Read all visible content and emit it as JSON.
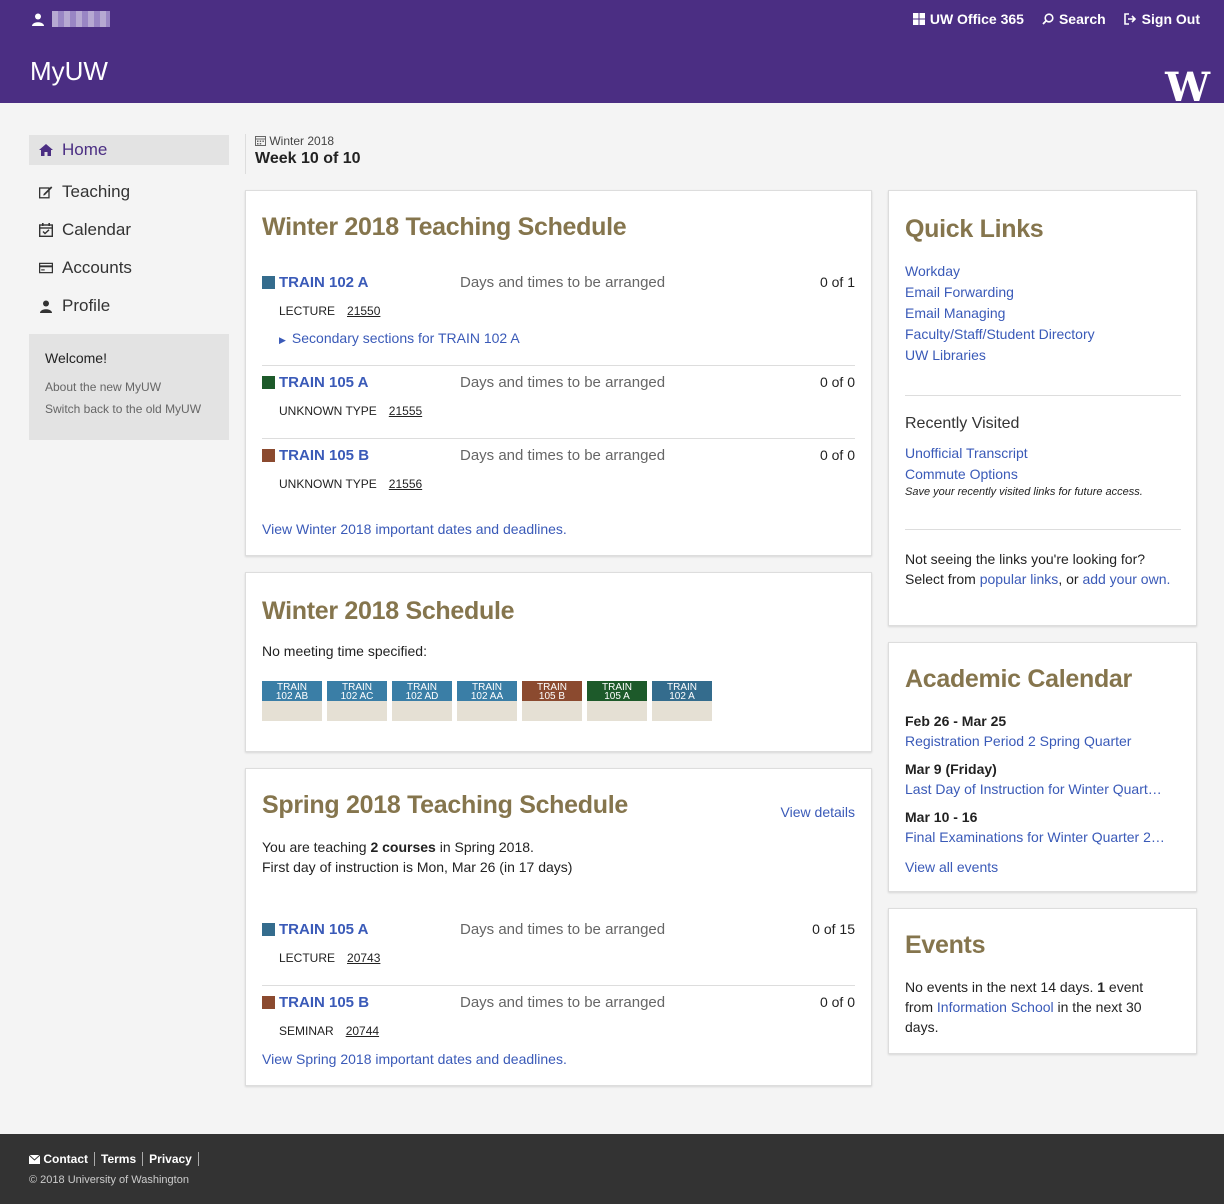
{
  "topbar": {
    "office": "UW Office 365",
    "search": "Search",
    "signout": "Sign Out"
  },
  "header": {
    "brand": "MyUW",
    "logo": "W"
  },
  "nav": [
    {
      "label": "Home",
      "icon": "home-icon"
    },
    {
      "label": "Teaching",
      "icon": "edit-icon"
    },
    {
      "label": "Calendar",
      "icon": "calendar-icon"
    },
    {
      "label": "Accounts",
      "icon": "credit-card-icon"
    },
    {
      "label": "Profile",
      "icon": "user-icon"
    }
  ],
  "welcome": {
    "title": "Welcome!",
    "about": "About the new MyUW",
    "switch": "Switch back to the old MyUW"
  },
  "term": {
    "quarter": "Winter 2018",
    "week": "Week 10 of 10"
  },
  "teaching_winter": {
    "title": "Winter 2018 Teaching Schedule",
    "courses": [
      {
        "name": "TRAIN 102 A",
        "when": "Days and times to be arranged",
        "count": "0 of 1",
        "type": "LECTURE",
        "sln": "21550",
        "color": "#346c8d",
        "secondary": "Secondary sections for TRAIN 102 A"
      },
      {
        "name": "TRAIN 105 A",
        "when": "Days and times to be arranged",
        "count": "0 of 0",
        "type": "UNKNOWN TYPE",
        "sln": "21555",
        "color": "#1d5a2a"
      },
      {
        "name": "TRAIN 105 B",
        "when": "Days and times to be arranged",
        "count": "0 of 0",
        "type": "UNKNOWN TYPE",
        "sln": "21556",
        "color": "#8b4a2f"
      }
    ],
    "dates_link": "View Winter 2018 important dates and deadlines."
  },
  "schedule": {
    "title": "Winter 2018 Schedule",
    "note": "No meeting time specified:",
    "blocks": [
      {
        "l1": "TRAIN",
        "l2": "102 AB",
        "color": "#3a7ea6"
      },
      {
        "l1": "TRAIN",
        "l2": "102 AC",
        "color": "#3a7ea6"
      },
      {
        "l1": "TRAIN",
        "l2": "102 AD",
        "color": "#3a7ea6"
      },
      {
        "l1": "TRAIN",
        "l2": "102 AA",
        "color": "#3a7ea6"
      },
      {
        "l1": "TRAIN",
        "l2": "105 B",
        "color": "#8b4a2f"
      },
      {
        "l1": "TRAIN",
        "l2": "105 A",
        "color": "#1d5a2a"
      },
      {
        "l1": "TRAIN",
        "l2": "102 A",
        "color": "#346c8d"
      }
    ]
  },
  "teaching_spring": {
    "title": "Spring 2018 Teaching Schedule",
    "details": "View details",
    "line1_pre": "You are teaching ",
    "line1_bold": "2 courses",
    "line1_post": " in Spring 2018.",
    "line2": "First day of instruction is Mon, Mar 26 (in 17 days)",
    "courses": [
      {
        "name": "TRAIN 105 A",
        "when": "Days and times to be arranged",
        "count": "0 of 15",
        "type": "LECTURE",
        "sln": "20743",
        "color": "#346c8d"
      },
      {
        "name": "TRAIN 105 B",
        "when": "Days and times to be arranged",
        "count": "0 of 0",
        "type": "SEMINAR",
        "sln": "20744",
        "color": "#8b4a2f"
      }
    ],
    "dates_link": "View Spring 2018 important dates and deadlines."
  },
  "quicklinks": {
    "title": "Quick Links",
    "links": [
      "Workday",
      "Email Forwarding",
      "Email Managing",
      "Faculty/Staff/Student Directory",
      "UW Libraries"
    ],
    "recent_title": "Recently Visited",
    "recent": [
      "Unofficial Transcript",
      "Commute Options"
    ],
    "recent_note": "Save your recently visited links for future access.",
    "not_seeing": "Not seeing the links you're looking for?",
    "select_from": "Select from ",
    "popular": "popular links",
    "or": ", or ",
    "add_own": "add your own."
  },
  "academic": {
    "title": "Academic Calendar",
    "events": [
      {
        "date": "Feb 26 - Mar 25",
        "name": "Registration Period 2 Spring Quarter"
      },
      {
        "date": "Mar 9 (Friday)",
        "name": "Last Day of Instruction for Winter Quart…"
      },
      {
        "date": "Mar 10 - 16",
        "name": "Final Examinations for Winter Quarter 2…"
      }
    ],
    "view_all": "View all events"
  },
  "events": {
    "title": "Events",
    "p1": "No events in the next 14 days. ",
    "p1_bold": "1",
    "p2": " event from ",
    "link": "Information School",
    "p3": " in the next 30 days."
  },
  "footer": {
    "contact": "Contact",
    "terms": "Terms",
    "privacy": "Privacy",
    "copyright": "© 2018 University of Washington"
  }
}
